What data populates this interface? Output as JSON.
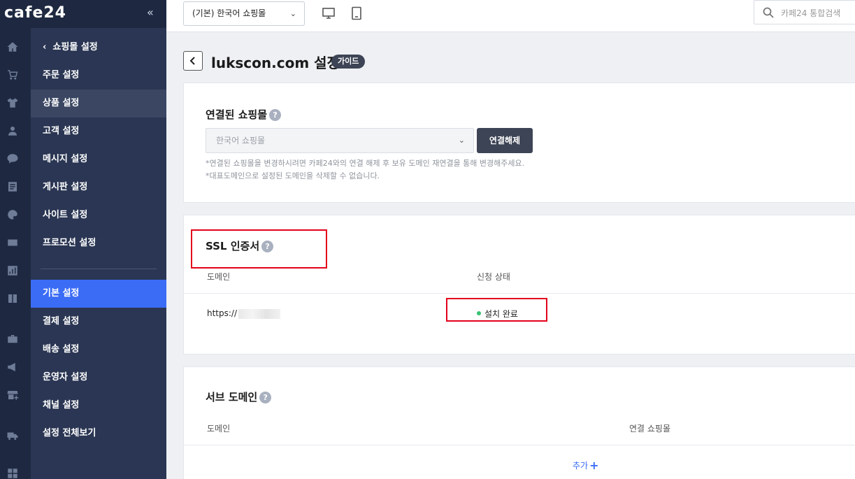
{
  "brand": {
    "logo": "cafe24",
    "collapse": "«"
  },
  "topbar": {
    "shop_select": "(기본) 한국어 쇼핑몰",
    "search_placeholder": "카페24 통합검색"
  },
  "sidebar": {
    "back_label": "쇼핑몰 설정",
    "items": [
      {
        "label": "주문 설정"
      },
      {
        "label": "상품 설정"
      },
      {
        "label": "고객 설정"
      },
      {
        "label": "메시지 설정"
      },
      {
        "label": "게시판 설정"
      },
      {
        "label": "사이트 설정"
      },
      {
        "label": "프로모션 설정"
      },
      {
        "label": "기본 설정"
      },
      {
        "label": "결제 설정"
      },
      {
        "label": "배송 설정"
      },
      {
        "label": "운영자 설정"
      },
      {
        "label": "채널 설정"
      },
      {
        "label": "설정 전체보기"
      }
    ],
    "active_item": "기본 설정",
    "hover_item": "상품 설정",
    "rail_icons": [
      "home-icon",
      "cart-icon",
      "shirt-icon",
      "user-icon",
      "chat-icon",
      "board-icon",
      "palette-icon",
      "promotion-icon",
      "chart-icon",
      "book-icon",
      "briefcase-icon",
      "megaphone-icon",
      "store-add-icon",
      "truck-icon",
      "apps-icon"
    ]
  },
  "page": {
    "title": "lukscon.com 설정",
    "guide_badge": "가이드"
  },
  "connected_shop": {
    "title": "연결된 쇼핑몰",
    "help": "?",
    "select_value": "한국어 쇼핑몰",
    "disconnect_label": "연결해제",
    "note1": "*연결된 쇼핑몰을 변경하시려면 카페24와의 연결 해제 후 보유 도메인 재연결을 통해 변경해주세요.",
    "note2": "*대표도메인으로 설정된 도메인을 삭제할 수 없습니다."
  },
  "ssl": {
    "title": "SSL 인증서",
    "help": "?",
    "col_domain": "도메인",
    "col_status": "신청 상태",
    "row_domain": "https://",
    "row_status": "설치 완료"
  },
  "sub_domain": {
    "title": "서브 도메인",
    "help": "?",
    "col_domain": "도메인",
    "col_shop": "연결 쇼핑몰",
    "add_label": "추가",
    "add_icon": "+"
  },
  "colors": {
    "sidebar_dark": "#1e2941",
    "sidebar_menu": "#2a3653",
    "active_blue": "#3b6cf5",
    "highlight_red": "#e3001b",
    "status_green": "#38c172"
  }
}
